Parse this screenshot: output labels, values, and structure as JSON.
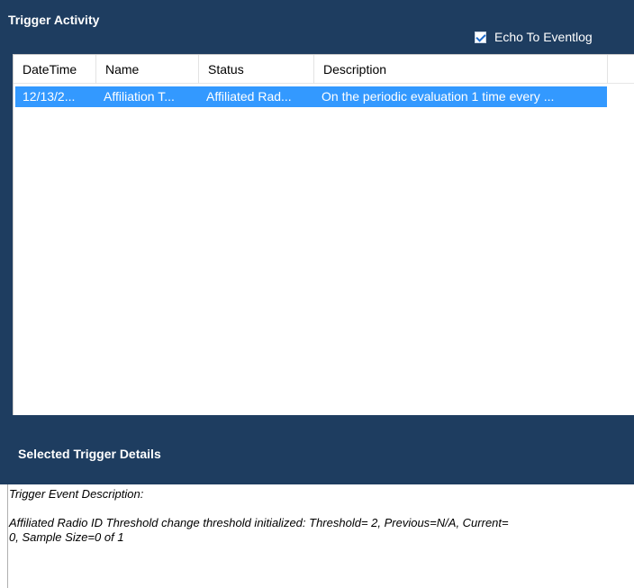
{
  "trigger_activity": {
    "title": "Trigger Activity",
    "echo_to_eventlog": {
      "label": "Echo To Eventlog",
      "checked": true
    },
    "columns": [
      "DateTime",
      "Name",
      "Status",
      "Description"
    ],
    "rows": [
      {
        "datetime": "12/13/2...",
        "name": "Affiliation T...",
        "status": "Affiliated Rad...",
        "description": "On the periodic evaluation 1 time every ...",
        "selected": true
      }
    ]
  },
  "selected_trigger_details": {
    "title": "Selected Trigger Details",
    "heading": "Trigger Event Description:",
    "text_line1": "Affiliated Radio ID Threshold change threshold initialized: Threshold= 2, Previous=N/A, Current=",
    "text_line2": "0, Sample Size=0 of 1"
  },
  "colors": {
    "panel_bg": "#1e3d60",
    "selection": "#3399ff"
  }
}
